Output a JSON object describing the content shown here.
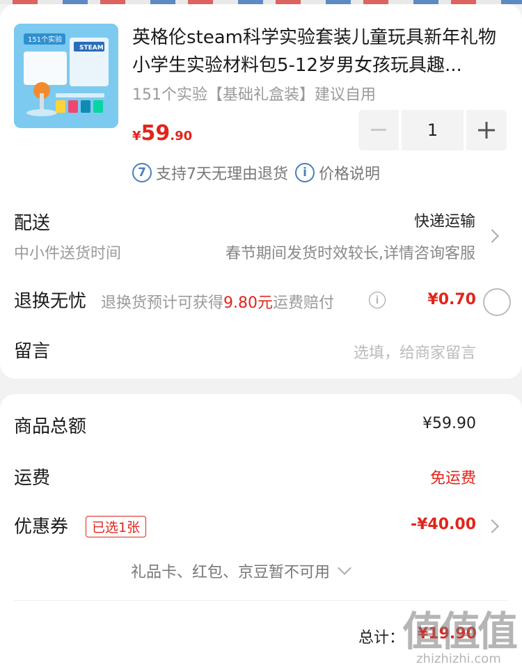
{
  "product": {
    "title": "英格伦steam科学实验套装儿童玩具新年礼物小学生实验材料包5-12岁男女孩玩具趣...",
    "spec": "151个实验【基础礼盒装】建议自用",
    "price_currency": "¥",
    "price_int": "59",
    "price_dec": ".90",
    "quantity": "1",
    "thumb_badge": "151个实验",
    "thumb_brand": "STEAM",
    "tags": [
      {
        "icon": "7",
        "text": "支持7天无理由退货"
      },
      {
        "icon": "i",
        "text": "价格说明"
      }
    ]
  },
  "delivery": {
    "label": "配送",
    "method": "快递运输",
    "time_label": "中小件送货时间",
    "time_note": "春节期间发货时效较长,详情咨询客服"
  },
  "return_service": {
    "label": "退换无忧",
    "desc_prefix": "退换货预计可获得",
    "amount": "9.80元",
    "desc_suffix": "运费赔付",
    "price": "¥0.70"
  },
  "message": {
    "label": "留言",
    "placeholder": "选填，给商家留言"
  },
  "summary": {
    "goods_total_label": "商品总额",
    "goods_total": "¥59.90",
    "shipping_label": "运费",
    "shipping": "免运费",
    "coupon_label": "优惠券",
    "coupon_badge": "已选1张",
    "coupon_value": "-¥40.00",
    "giftcard_note": "礼品卡、红包、京豆暂不可用",
    "total_label": "总计：",
    "total_value": "¥19.90"
  },
  "watermark": {
    "big": "值值值",
    "small": "zhizhizhi.com"
  },
  "colors": {
    "accent_red": "#e1251b",
    "icon_blue": "#4a7ebf"
  }
}
